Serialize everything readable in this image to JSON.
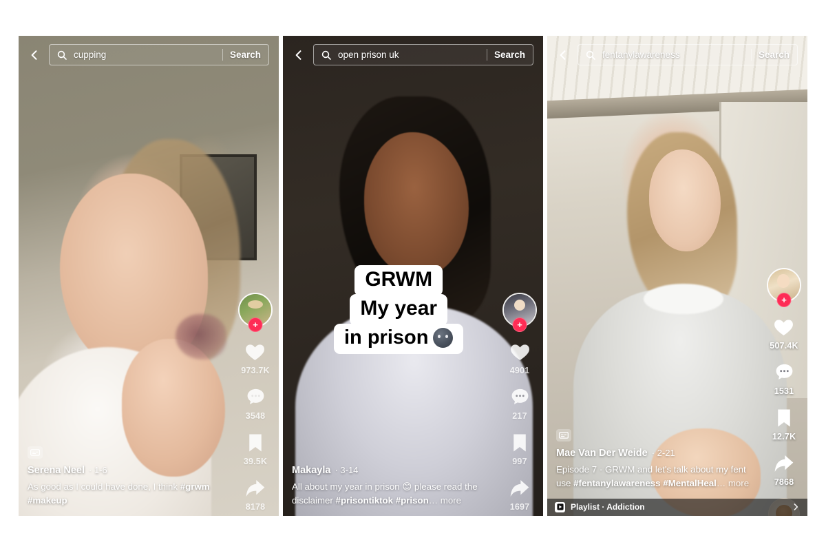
{
  "app": "tiktok-search-results",
  "colors": {
    "accent": "#fe2c55",
    "text_on_video": "#ffffff",
    "playlist_bar": "rgba(18,18,18,0.62)"
  },
  "panels": [
    {
      "id": "panel-1",
      "search": {
        "query": "cupping",
        "placeholder": "Search",
        "button_label": "Search",
        "back_icon": "chevron-left-icon",
        "search_icon": "search-icon"
      },
      "author": "Serena Neel",
      "date": "1-6",
      "date_separator": "·",
      "description_plain": "As good as I could have done, I think ",
      "hashtags": "#grwm #makeup",
      "cc_badge": "closed-caption-icon",
      "actions": {
        "like_icon": "heart-icon",
        "like_count": "973.7K",
        "comment_icon": "comment-icon",
        "comment_count": "3548",
        "bookmark_icon": "bookmark-icon",
        "bookmark_count": "39.5K",
        "share_icon": "share-arrow-icon",
        "share_count": "8178",
        "follow_icon": "plus-icon",
        "follow_label": "+",
        "avatar": "author-avatar",
        "music_disc": "music-disc-icon"
      },
      "sticker": null,
      "playlist": null
    },
    {
      "id": "panel-2",
      "search": {
        "query": "open prison uk",
        "placeholder": "Search",
        "button_label": "Search",
        "back_icon": "chevron-left-icon",
        "search_icon": "search-icon"
      },
      "author": "Makayla",
      "date": "3-14",
      "date_separator": "·",
      "description_plain": "All about my year in prison 😊 please read the disclaimer ",
      "hashtags": "#prisontiktok #prison",
      "more_label": "… more",
      "cc_badge": null,
      "actions": {
        "like_icon": "heart-icon",
        "like_count": "4901",
        "comment_icon": "comment-icon",
        "comment_count": "217",
        "bookmark_icon": "bookmark-icon",
        "bookmark_count": "997",
        "share_icon": "share-arrow-icon",
        "share_count": "1697",
        "follow_icon": "plus-icon",
        "follow_label": "+",
        "avatar": "author-avatar",
        "music_disc": "music-disc-icon"
      },
      "sticker": {
        "line1": "GRWM",
        "line2": "My year",
        "line3": "in prison",
        "emoji": "new-moon-face-emoji"
      },
      "playlist": null
    },
    {
      "id": "panel-3",
      "search": {
        "query": "fentanylawareness",
        "placeholder": "Search",
        "button_label": "Search",
        "back_icon": "chevron-left-icon",
        "search_icon": "search-icon"
      },
      "author": "Mae Van Der Weide",
      "date": "2-21",
      "date_separator": "·",
      "description_plain": "Episode 7 · GRWM and let's talk about my fent use ",
      "hashtags": "#fentanylawareness #MentalHeal",
      "more_label": "… more",
      "cc_badge": "closed-caption-icon",
      "actions": {
        "like_icon": "heart-icon",
        "like_count": "507.4K",
        "comment_icon": "comment-icon",
        "comment_count": "1531",
        "bookmark_icon": "bookmark-icon",
        "bookmark_count": "12.7K",
        "share_icon": "share-arrow-icon",
        "share_count": "7868",
        "follow_icon": "plus-icon",
        "follow_label": "+",
        "avatar": "author-avatar",
        "music_disc": "music-disc-icon"
      },
      "sticker": null,
      "playlist": {
        "icon": "playlist-icon",
        "label": "Playlist · Addiction",
        "chevron": "chevron-right-icon"
      }
    }
  ]
}
